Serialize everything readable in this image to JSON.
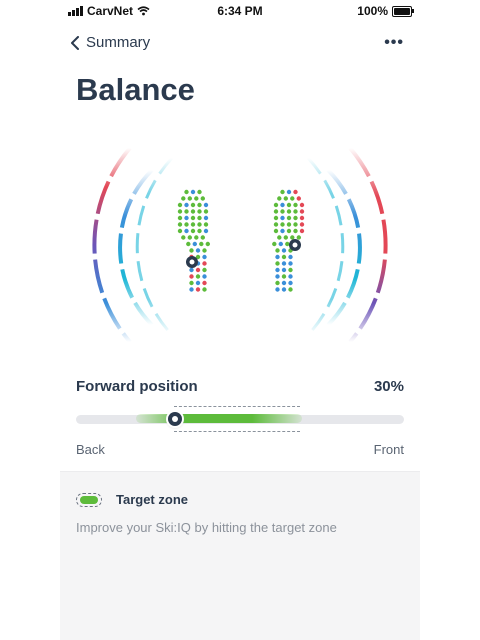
{
  "status_bar": {
    "carrier": "CarvNet",
    "time": "6:34 PM",
    "battery": "100%"
  },
  "nav": {
    "back_label": "Summary"
  },
  "page": {
    "title": "Balance"
  },
  "metric": {
    "label": "Forward position",
    "value": "30%",
    "slider_position": 0.3,
    "min_label": "Back",
    "max_label": "Front"
  },
  "legend": {
    "label": "Target zone",
    "hint": "Improve your Ski:IQ by hitting the target zone"
  },
  "colors": {
    "heading": "#2b3a4e",
    "target_green": "#5dbb3b",
    "pressure_blue": "#3b8fd9",
    "pressure_red": "#e34856",
    "arc_cyan": "#1fb7d6",
    "arc_purple": "#6c54b8"
  },
  "icons": [
    "signal-icon",
    "wifi-icon",
    "battery-icon",
    "chevron-left-icon",
    "more-icon"
  ]
}
